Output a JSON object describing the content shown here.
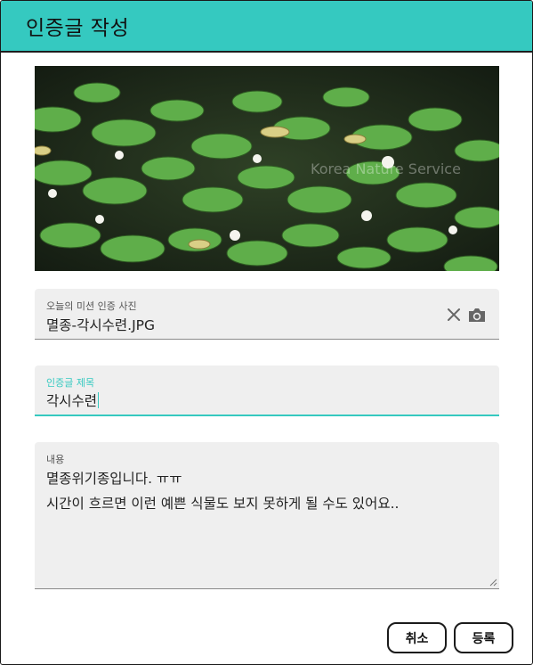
{
  "dialog": {
    "title": "인증글 작성"
  },
  "photo": {
    "watermark": "Korea Nature Service",
    "icon": "water-lily-photo"
  },
  "fields": {
    "photo_file": {
      "label": "오늘의 미션 인증 사진",
      "value": "멸종-각시수련.JPG",
      "clear_icon": "close-icon",
      "camera_icon": "camera-icon"
    },
    "title": {
      "label": "인증글 제목",
      "value": "각시수련"
    },
    "content": {
      "label": "내용",
      "line1": "멸종위기종입니다. ㅠㅠ",
      "line2": "시간이 흐르면 이런 예쁜 식물도 보지 못하게 될 수도 있어요.."
    }
  },
  "buttons": {
    "cancel": "취소",
    "submit": "등록"
  },
  "colors": {
    "accent": "#35c9c0",
    "field_bg": "#efefef"
  }
}
